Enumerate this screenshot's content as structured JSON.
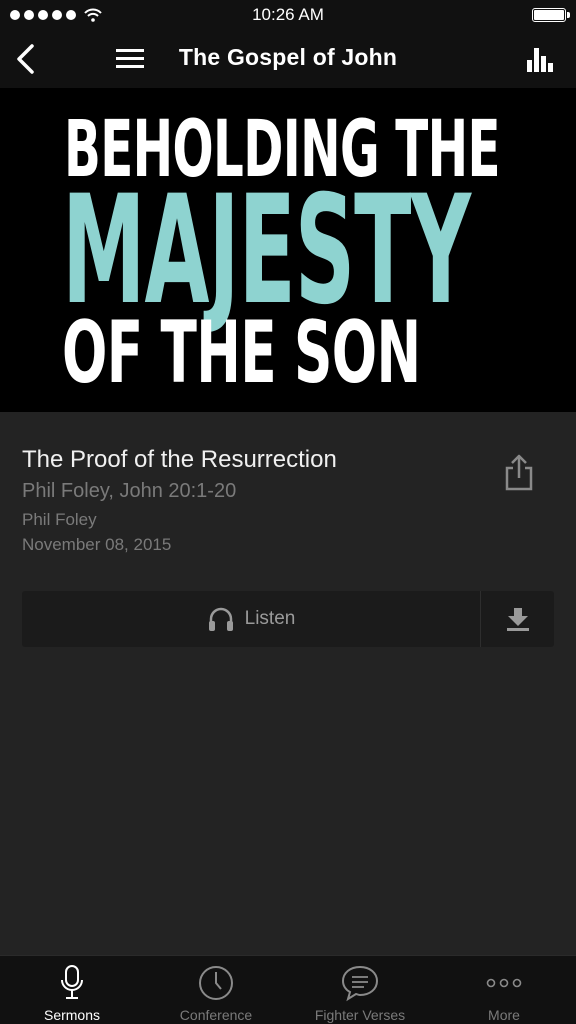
{
  "status_bar": {
    "time": "10:26 AM"
  },
  "nav": {
    "title": "The Gospel of John"
  },
  "hero": {
    "line1": "BEHOLDING THE",
    "line2": "MAJESTY",
    "line3": "OF THE SON",
    "accent_color": "#8ed3d0"
  },
  "sermon": {
    "title": "The Proof of the Resurrection",
    "subtitle": "Phil Foley, John 20:1-20",
    "speaker": "Phil Foley",
    "date": "November 08, 2015"
  },
  "actions": {
    "listen_label": "Listen"
  },
  "tabs": [
    {
      "label": "Sermons",
      "icon": "microphone-icon",
      "active": true
    },
    {
      "label": "Conference",
      "icon": "clock-icon",
      "active": false
    },
    {
      "label": "Fighter Verses",
      "icon": "speech-bubble-icon",
      "active": false
    },
    {
      "label": "More",
      "icon": "more-dots-icon",
      "active": false
    }
  ]
}
